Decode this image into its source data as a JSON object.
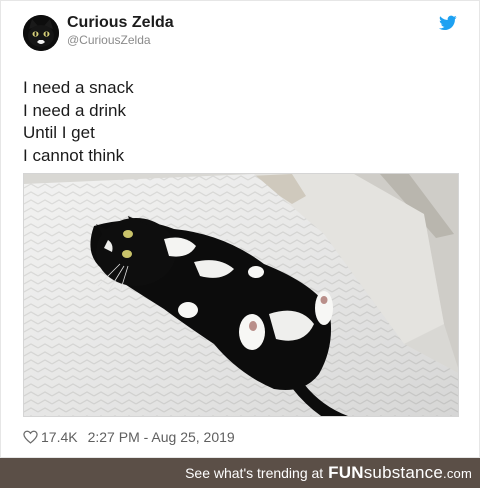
{
  "profile": {
    "name": "Curious Zelda",
    "handle": "@CuriousZelda",
    "avatar_icon": "cat-face-avatar"
  },
  "platform_icon": "twitter-bird-icon",
  "tweet": {
    "lines": [
      "I need a snack",
      "I need a drink",
      "Until I get",
      "I cannot think"
    ]
  },
  "photo": {
    "subject": "tuxedo-cat-photo"
  },
  "meta": {
    "likes": "17.4K",
    "timestamp": "2:27 PM - Aug 25, 2019"
  },
  "footer": {
    "trending_text": "See what's trending at",
    "brand_bold": "FUN",
    "brand_rest": "substance",
    "brand_tld": ".com"
  },
  "colors": {
    "twitter_blue": "#1da1f2",
    "footer_bg": "#5b4f47",
    "text_dark": "#1b1b1b",
    "text_muted": "#5f5f5f"
  }
}
